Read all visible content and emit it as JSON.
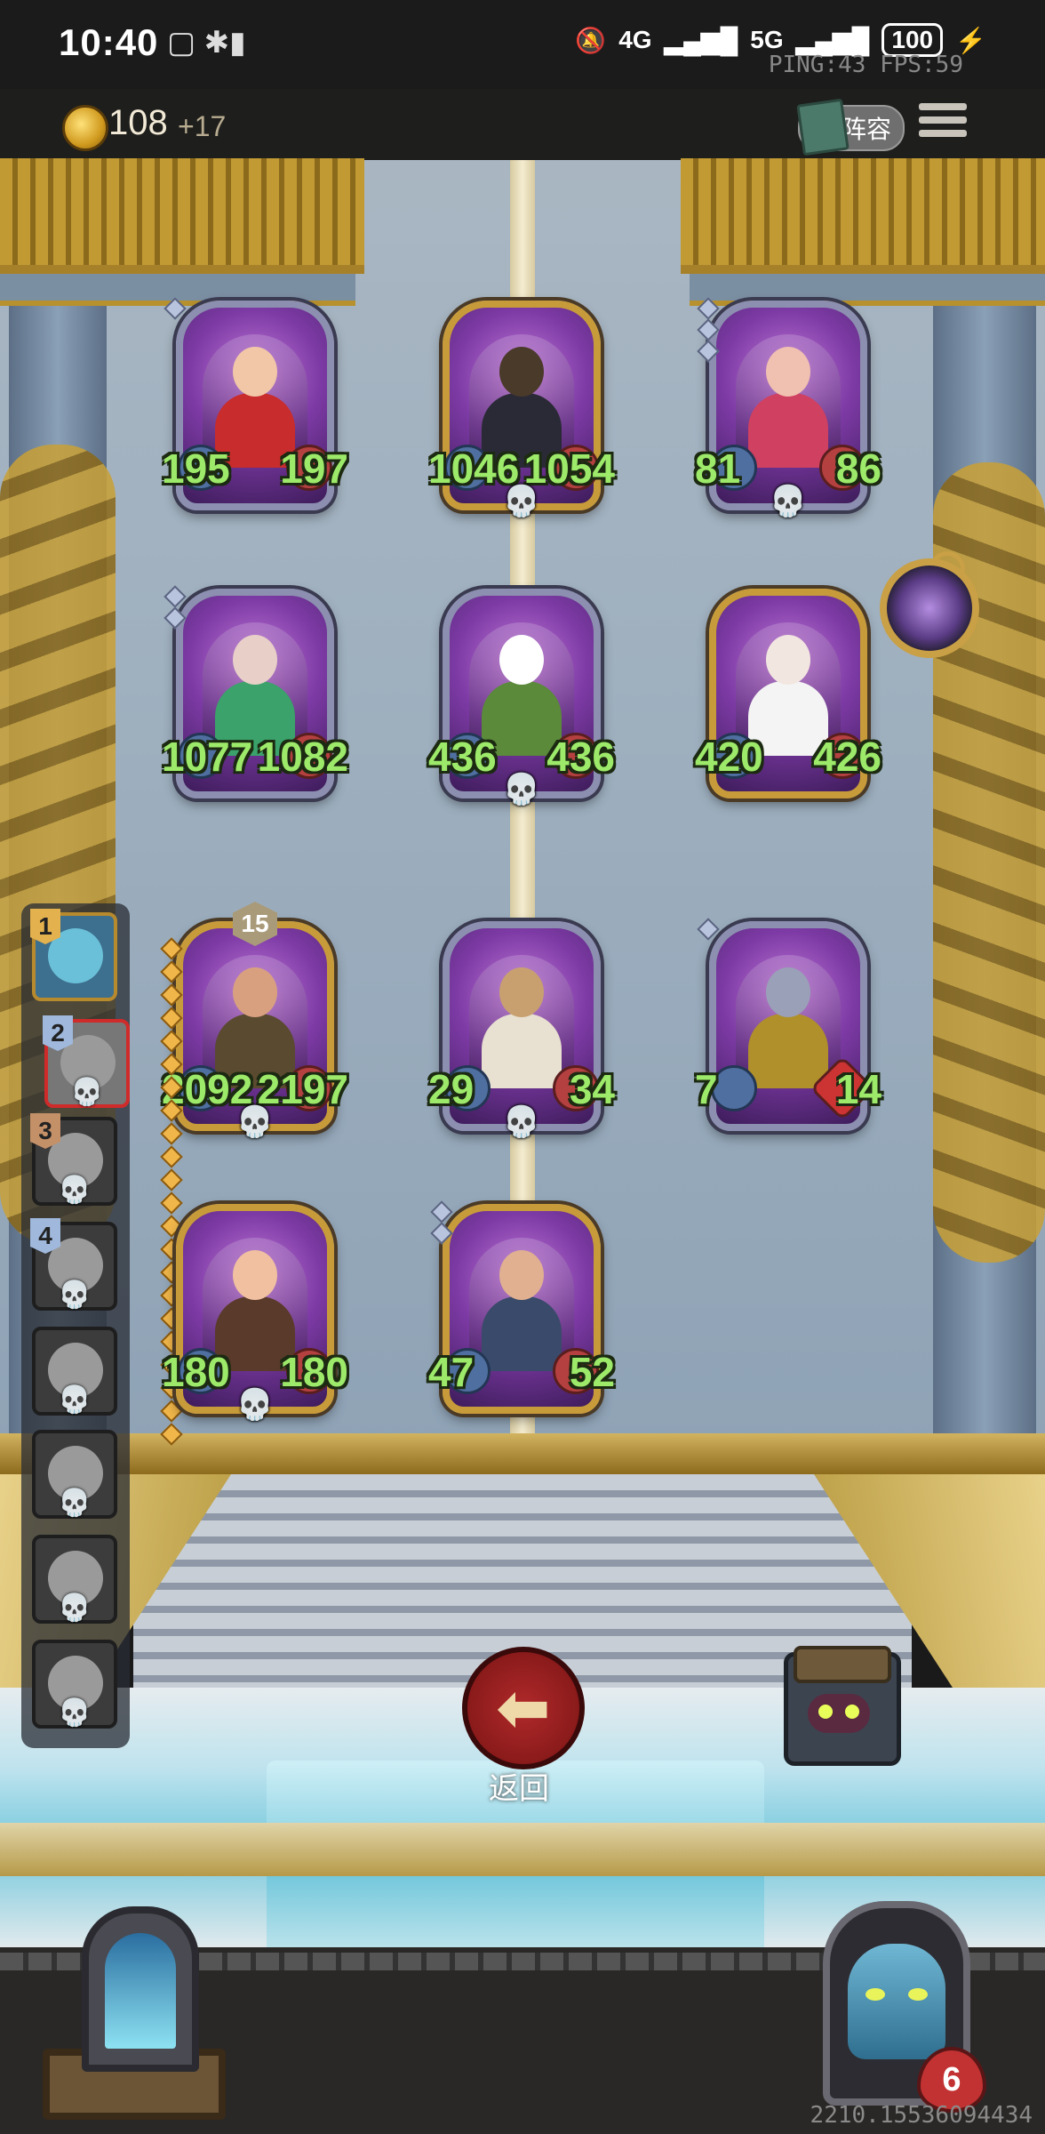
{
  "status_bar": {
    "time": "10:40",
    "network": "4G",
    "network2": "5G",
    "battery": "100",
    "ping_fps": "PING:43   FPS:59"
  },
  "top_bar": {
    "gold": "108",
    "gold_income": "+17",
    "lineup_label": "阵容"
  },
  "board": {
    "rows": [
      [
        {
          "attack": "195",
          "health": "197",
          "frame": "silver",
          "tier_diamonds": 1,
          "skull": false
        },
        {
          "attack": "1046",
          "health": "1054",
          "frame": "gold",
          "tier_diamonds": 0,
          "skull": true
        },
        {
          "attack": "81",
          "health": "86",
          "frame": "silver",
          "tier_diamonds": 3,
          "skull": true
        }
      ],
      [
        {
          "attack": "1077",
          "health": "1082",
          "frame": "silver",
          "tier_diamonds": 2,
          "skull": false
        },
        {
          "attack": "436",
          "health": "436",
          "frame": "silver",
          "tier_diamonds": 0,
          "skull": true
        },
        {
          "attack": "420",
          "health": "426",
          "frame": "gold",
          "tier_diamonds": 0,
          "skull": false
        }
      ],
      [
        {
          "attack": "2092",
          "health": "2197",
          "frame": "gold",
          "level": "15",
          "skull": true
        },
        {
          "attack": "29",
          "health": "34",
          "frame": "silver",
          "tier_diamonds": 0,
          "skull": true
        },
        {
          "attack": "7",
          "health": "14",
          "frame": "silver",
          "tier_diamonds": 1,
          "skull": false
        }
      ],
      [
        {
          "attack": "180",
          "health": "180",
          "frame": "gold",
          "tier_diamonds": 0,
          "skull": true
        },
        {
          "attack": "47",
          "health": "52",
          "frame": "gold",
          "tier_diamonds": 2,
          "skull": false
        }
      ]
    ]
  },
  "roster": {
    "slots": [
      {
        "rank": "1",
        "state": "active"
      },
      {
        "rank": "2",
        "state": "selected"
      },
      {
        "rank": "3",
        "state": "eliminated"
      },
      {
        "rank": "4",
        "state": "eliminated"
      },
      {
        "rank": "",
        "state": "eliminated"
      },
      {
        "rank": "",
        "state": "eliminated"
      },
      {
        "rank": "",
        "state": "eliminated"
      },
      {
        "rank": "",
        "state": "eliminated"
      }
    ]
  },
  "actions": {
    "back_label": "返回"
  },
  "player": {
    "health": "6"
  },
  "footer": {
    "build_id": "2210.15536094434"
  },
  "colors": {
    "stat_text": "#9dea6a",
    "gold_frame": "#c89b3a",
    "silver_frame": "#8c8fb0",
    "back_button": "#b0292a"
  }
}
